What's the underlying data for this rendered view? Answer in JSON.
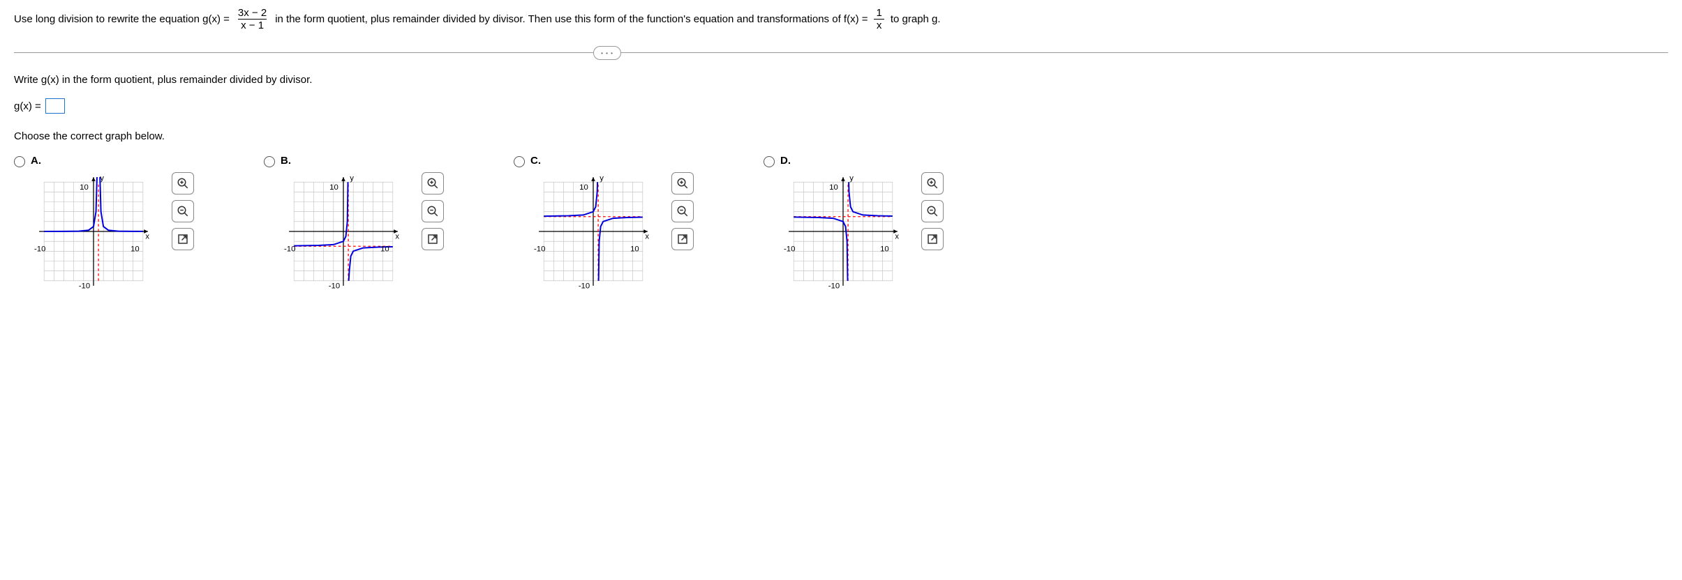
{
  "question": {
    "part1": "Use long division to rewrite the equation g(x) =",
    "frac1_num": "3x − 2",
    "frac1_den": "x − 1",
    "part2": "in the form quotient, plus remainder divided by divisor.  Then use this form of the function's equation and transformations of f(x) =",
    "frac2_num": "1",
    "frac2_den": "x",
    "part3": "to graph g."
  },
  "sub1": "Write g(x) in the form quotient, plus remainder divided by divisor.",
  "gx_label": "g(x) =",
  "sub2": "Choose the correct graph below.",
  "choices": {
    "a": "A.",
    "b": "B.",
    "c": "C.",
    "d": "D."
  },
  "axis": {
    "x": "x",
    "y": "y",
    "pos10": "10",
    "neg10": "-10"
  },
  "chart_data": [
    {
      "type": "line",
      "title": "Choice A",
      "xlim": [
        -10,
        10
      ],
      "ylim": [
        -10,
        10
      ],
      "vertical_asymptote": 1,
      "horizontal_asymptote": null,
      "formula": "1/(x-1)^2",
      "sample_points": [
        [
          -3,
          0.06
        ],
        [
          -1,
          0.25
        ],
        [
          0,
          1
        ],
        [
          0.5,
          4
        ],
        [
          1.5,
          4
        ],
        [
          2,
          1
        ],
        [
          3,
          0.25
        ],
        [
          5,
          0.06
        ]
      ]
    },
    {
      "type": "line",
      "title": "Choice B",
      "xlim": [
        -10,
        10
      ],
      "ylim": [
        -10,
        10
      ],
      "vertical_asymptote": 1,
      "horizontal_asymptote": -3,
      "formula": "-3 - 1/(x-1)",
      "sample_points": [
        [
          -9,
          -2.9
        ],
        [
          -3,
          -2.75
        ],
        [
          0,
          -2
        ],
        [
          0.5,
          -1
        ],
        [
          0.9,
          7
        ],
        [
          1.1,
          -13
        ],
        [
          1.5,
          -5
        ],
        [
          2,
          -4
        ],
        [
          5,
          -3.25
        ],
        [
          9,
          -3.1
        ]
      ]
    },
    {
      "type": "line",
      "title": "Choice C",
      "xlim": [
        -10,
        10
      ],
      "ylim": [
        -10,
        10
      ],
      "vertical_asymptote": 1,
      "horizontal_asymptote": 3,
      "formula": "3 - 1/(x-1)",
      "sample_points": [
        [
          -9,
          3.1
        ],
        [
          -3,
          3.25
        ],
        [
          0,
          4
        ],
        [
          0.5,
          5
        ],
        [
          0.9,
          13
        ],
        [
          1.1,
          -7
        ],
        [
          1.5,
          1
        ],
        [
          2,
          2
        ],
        [
          5,
          2.75
        ],
        [
          9,
          2.9
        ]
      ]
    },
    {
      "type": "line",
      "title": "Choice D",
      "xlim": [
        -10,
        10
      ],
      "ylim": [
        -10,
        10
      ],
      "vertical_asymptote": 1,
      "horizontal_asymptote": 3,
      "formula": "3 + 1/(x-1)",
      "sample_points": [
        [
          -9,
          2.9
        ],
        [
          -3,
          2.75
        ],
        [
          0,
          2
        ],
        [
          0.5,
          1
        ],
        [
          0.9,
          -7
        ],
        [
          1.1,
          13
        ],
        [
          1.5,
          5
        ],
        [
          2,
          4
        ],
        [
          5,
          3.25
        ],
        [
          9,
          3.1
        ]
      ]
    }
  ]
}
